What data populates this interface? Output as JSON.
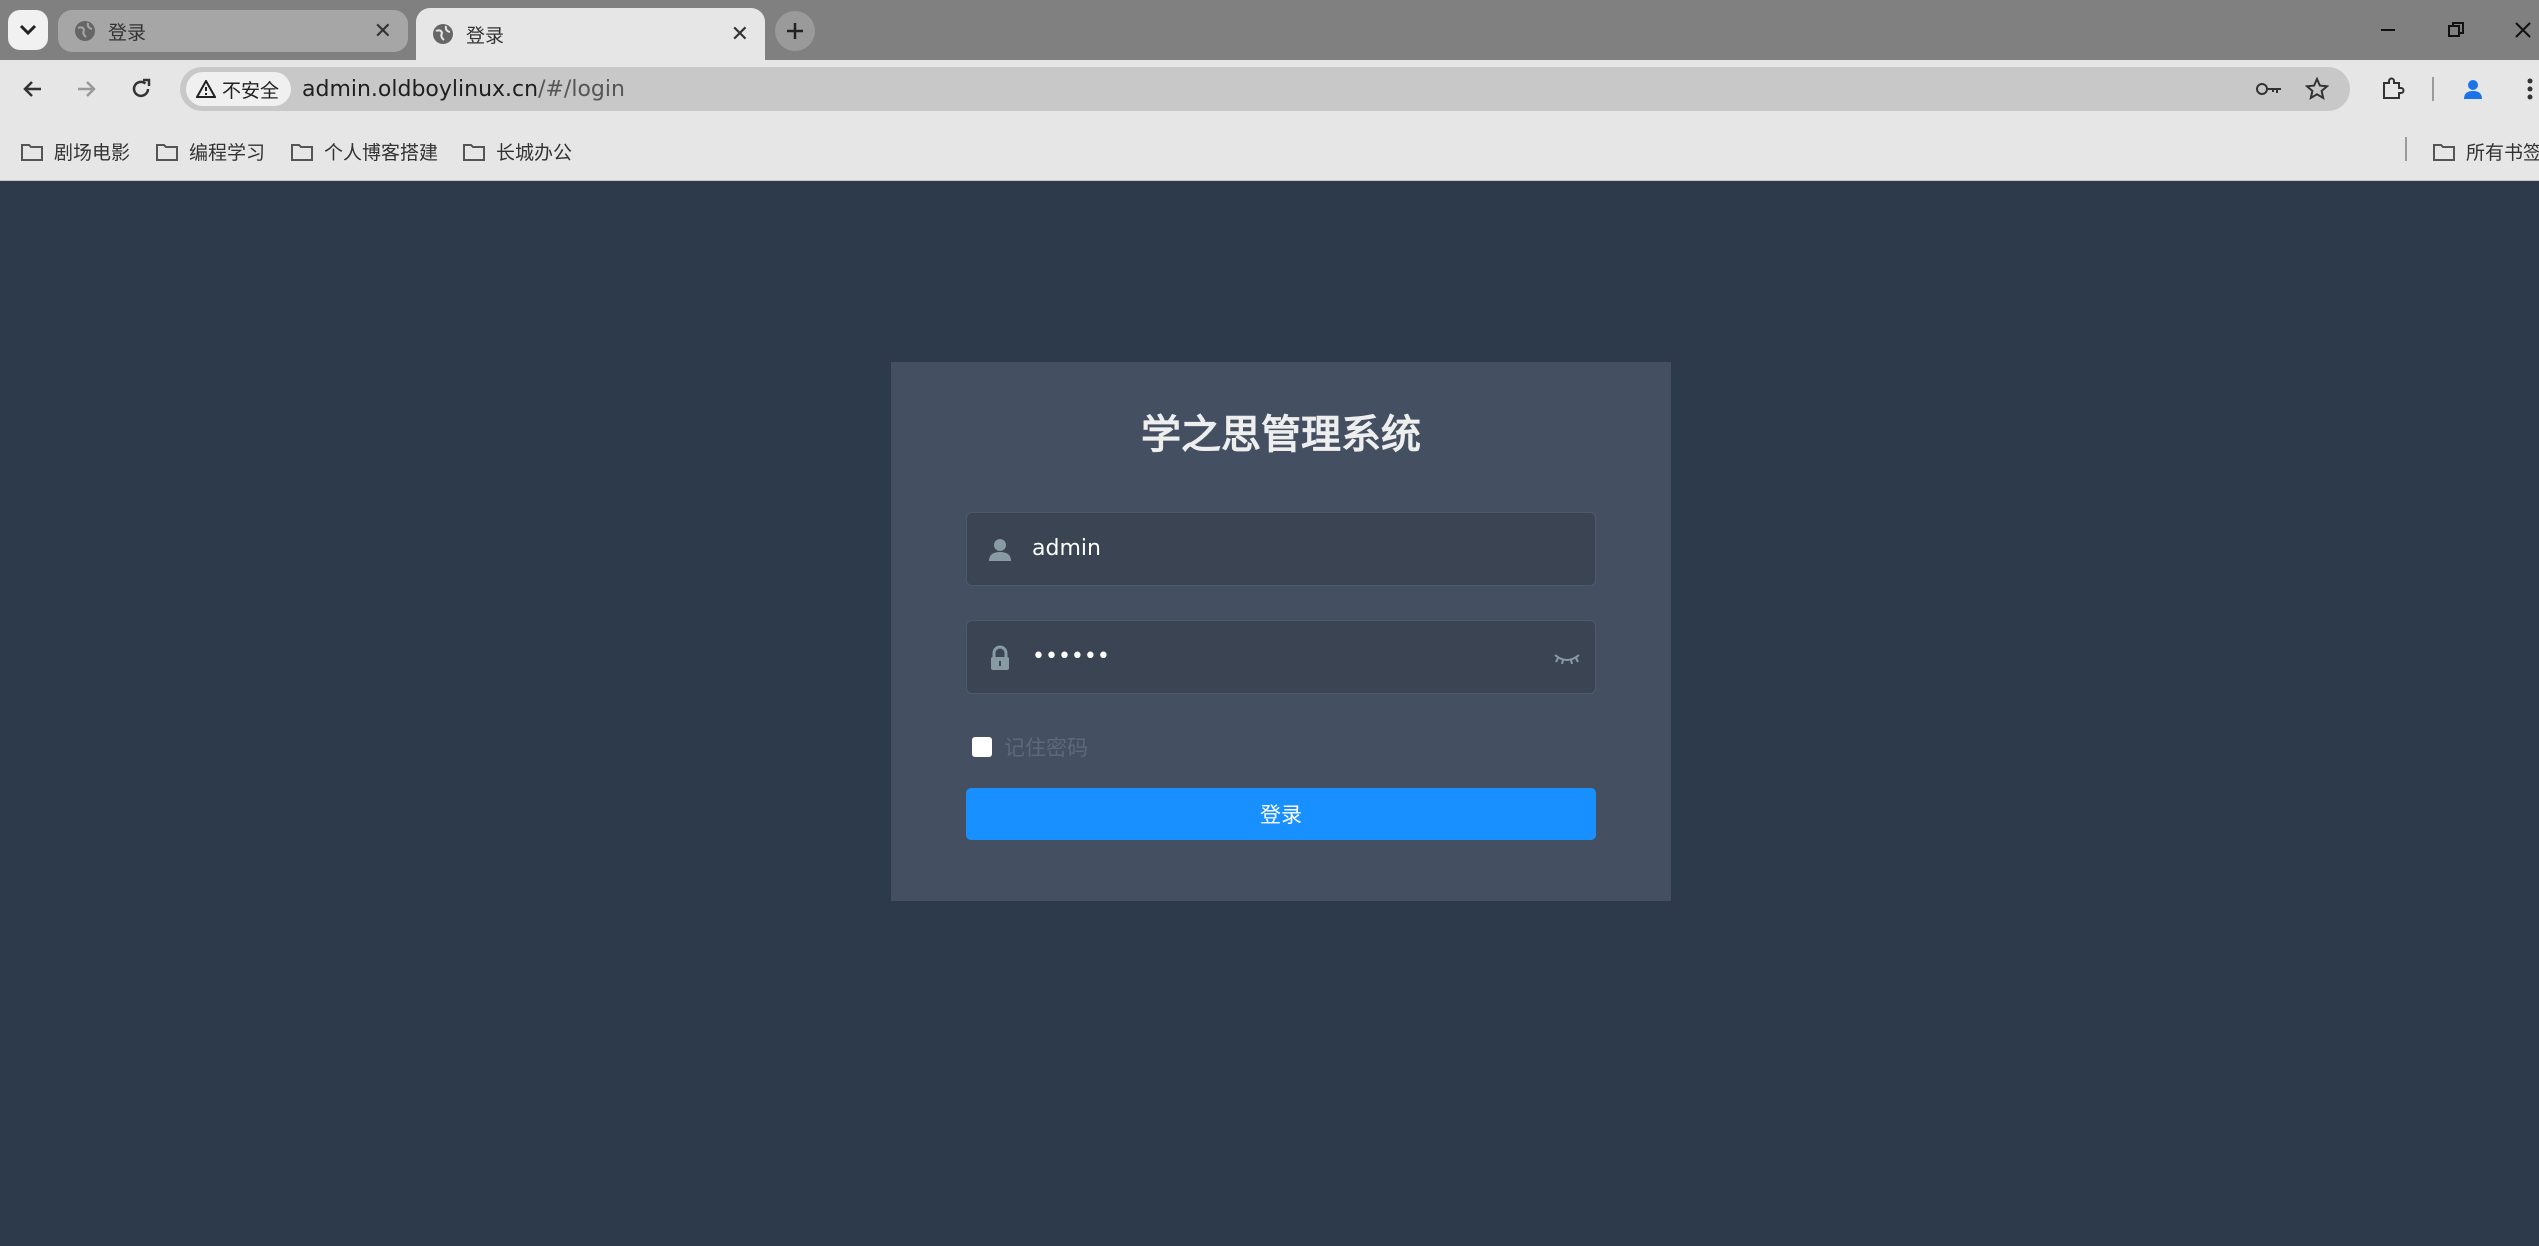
{
  "browser": {
    "tabs": [
      {
        "title": "登录",
        "active": false
      },
      {
        "title": "登录",
        "active": true
      }
    ],
    "security_chip": "不安全",
    "url_host": "admin.oldboylinux.cn",
    "url_path": "/#/login",
    "bookmarks": [
      "剧场电影",
      "编程学习",
      "个人博客搭建",
      "长城办公"
    ],
    "all_bookmarks": "所有书签"
  },
  "login": {
    "title": "学之思管理系统",
    "username": "admin",
    "password_masked": "••••••",
    "remember_label": "记住密码",
    "submit_label": "登录"
  },
  "colors": {
    "page_bg": "#2d3a4b",
    "card_bg": "#445061",
    "button": "#1890ff"
  }
}
